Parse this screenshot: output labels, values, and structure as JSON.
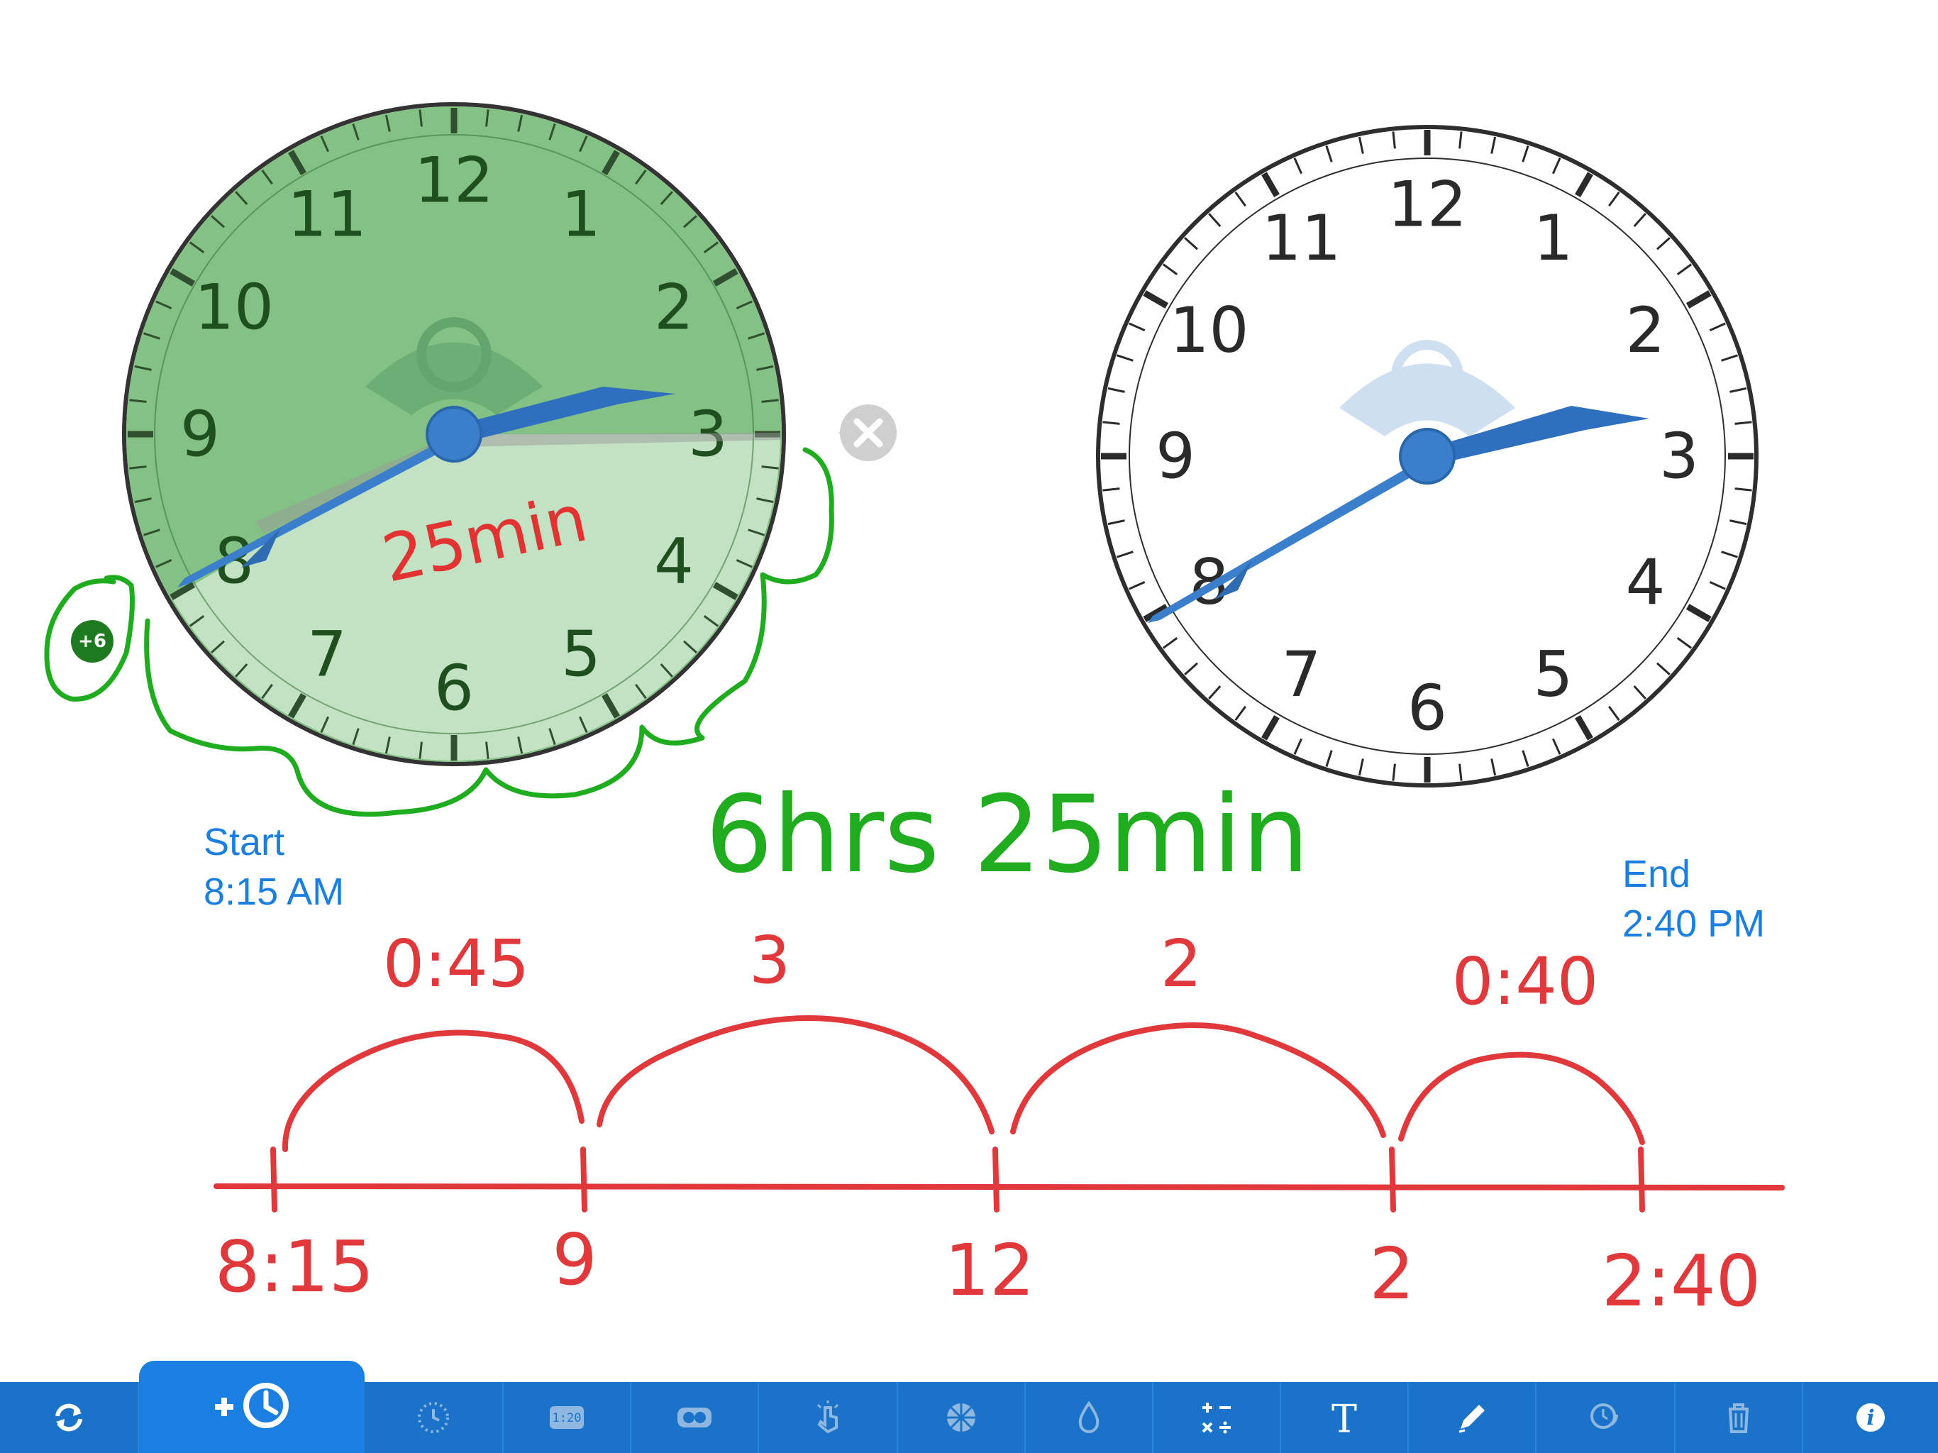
{
  "colors": {
    "accent": "#1a73c8",
    "hand_blue": "#3b7fcc",
    "ink_red": "#e0383b",
    "ink_green": "#1fad1f",
    "clock_green_dark": "#84c184",
    "clock_green_light": "#c3e2c3",
    "label_blue": "#1a7fe0"
  },
  "clocks": [
    {
      "id": "start-clock",
      "numbers": [
        "12",
        "1",
        "2",
        "3",
        "4",
        "5",
        "6",
        "7",
        "8",
        "9",
        "10",
        "11"
      ],
      "time": "8:15",
      "elapsed_label": "25min",
      "hour_offset_badge": "+6",
      "close_icon": "close-icon"
    },
    {
      "id": "end-clock",
      "numbers": [
        "12",
        "1",
        "2",
        "3",
        "4",
        "5",
        "6",
        "7",
        "8",
        "9",
        "10",
        "11"
      ],
      "time": "2:40"
    }
  ],
  "labels": {
    "start_title": "Start",
    "start_time": "8:15 AM",
    "end_title": "End",
    "end_time": "2:40 PM"
  },
  "annotations": {
    "total_elapsed": "6hrs 25min",
    "jumps": [
      "0:45",
      "3",
      "2",
      "0:40"
    ],
    "ticks": [
      "8:15",
      "9",
      "12",
      "2",
      "2:40"
    ]
  },
  "toolbar": {
    "items": [
      {
        "name": "refresh-button",
        "icon": "refresh-icon"
      },
      {
        "name": "add-clock-button",
        "icon": "add-clock-icon"
      },
      {
        "name": "clock-face-button",
        "icon": "clock-dotted-icon"
      },
      {
        "name": "digital-clock-button",
        "icon": "digital-display-icon",
        "glyph": "1:20"
      },
      {
        "name": "toggle-button",
        "icon": "toggle-icon"
      },
      {
        "name": "gesture-button",
        "icon": "tap-icon"
      },
      {
        "name": "fraction-wheel-button",
        "icon": "pie-icon"
      },
      {
        "name": "color-fill-button",
        "icon": "droplet-icon"
      },
      {
        "name": "operations-button",
        "icon": "math-operators-icon"
      },
      {
        "name": "text-tool-button",
        "icon": "text-icon",
        "glyph": "T"
      },
      {
        "name": "pen-tool-button",
        "icon": "pen-icon"
      },
      {
        "name": "elapsed-time-button",
        "icon": "elapsed-clock-icon"
      },
      {
        "name": "trash-button",
        "icon": "trash-icon"
      },
      {
        "name": "info-button",
        "icon": "info-icon",
        "glyph": "i"
      }
    ]
  }
}
